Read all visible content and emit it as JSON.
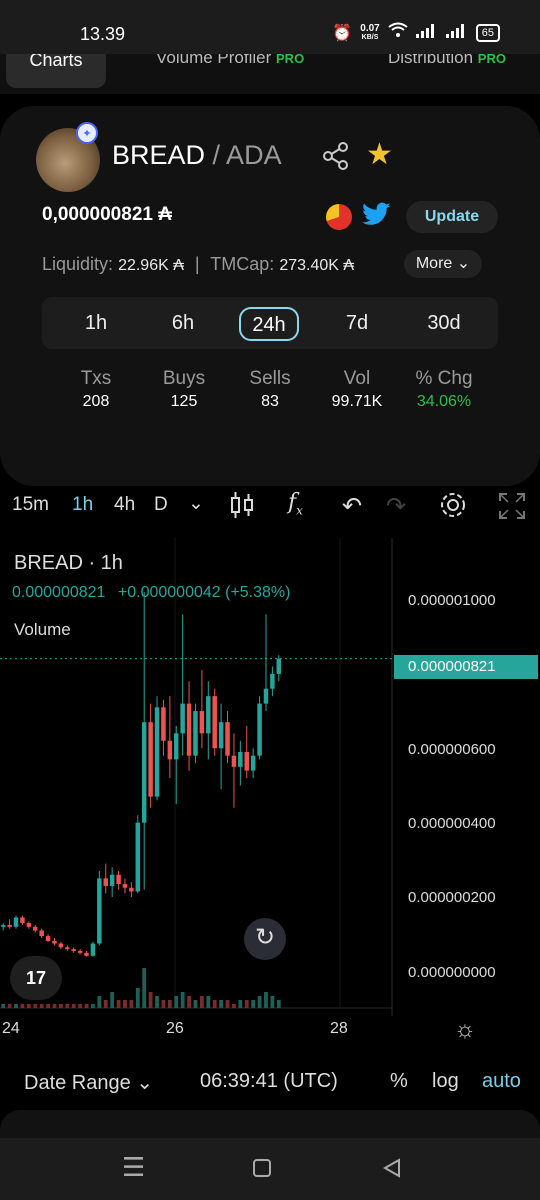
{
  "status_bar": {
    "time": "13.39",
    "net_speed": "0.07",
    "net_unit": "KB/S",
    "battery": "65"
  },
  "top_tabs": [
    {
      "label": "Charts",
      "pro": ""
    },
    {
      "label": "Volume Profiler",
      "pro": "PRO"
    },
    {
      "label": "Distribution",
      "pro": "PRO"
    }
  ],
  "token": {
    "base": "BREAD",
    "quote": "/ ADA",
    "price": "0,000000821 ₳",
    "update_label": "Update",
    "liquidity_label": "Liquidity:",
    "liquidity_value": "22.96K ₳",
    "separator": "|",
    "tmcap_label": "TMCap:",
    "tmcap_value": "273.40K ₳",
    "more_label": "More ⌄"
  },
  "timeframes": [
    "1h",
    "6h",
    "24h",
    "7d",
    "30d"
  ],
  "active_timeframe": "24h",
  "stats": [
    {
      "label": "Txs",
      "value": "208"
    },
    {
      "label": "Buys",
      "value": "125"
    },
    {
      "label": "Sells",
      "value": "83"
    },
    {
      "label": "Vol",
      "value": "99.71K"
    },
    {
      "label": "% Chg",
      "value": "34.06%"
    }
  ],
  "chart_toolbar": {
    "intervals": [
      "15m",
      "1h",
      "4h",
      "D"
    ],
    "active_interval": "1h",
    "dropdown": "⌄"
  },
  "chart_legend": {
    "title": "BREAD · 1h",
    "price": "0.000000821",
    "change": "+0.000000042 (+5.38%)",
    "volume_label": "Volume"
  },
  "chart_data": {
    "type": "candlestick",
    "series_name": "BREAD · 1h",
    "y_ticks": [
      "0.000001000",
      "0.000000800",
      "0.000000600",
      "0.000000400",
      "0.000000200",
      "0.000000000"
    ],
    "x_ticks": [
      "24",
      "26",
      "28"
    ],
    "last_price_label": "0.000000821",
    "ylim": [
      0,
      1.1e-06
    ],
    "colors": {
      "up": "#26a69a",
      "down": "#ef5350"
    },
    "candles_ohlc": [
      [
        1e-07,
        1.1e-07,
        9e-08,
        1.05e-07
      ],
      [
        1.05e-07,
        1.2e-07,
        9.5e-08,
        1e-07
      ],
      [
        1e-07,
        1.3e-07,
        9.5e-08,
        1.25e-07
      ],
      [
        1.25e-07,
        1.3e-07,
        1.05e-07,
        1.1e-07
      ],
      [
        1.1e-07,
        1.15e-07,
        9.5e-08,
        1e-07
      ],
      [
        1e-07,
        1.05e-07,
        8.5e-08,
        9e-08
      ],
      [
        9e-08,
        9.5e-08,
        7e-08,
        7.5e-08
      ],
      [
        7.5e-08,
        8e-08,
        6e-08,
        6.2e-08
      ],
      [
        6.2e-08,
        7e-08,
        5e-08,
        5.5e-08
      ],
      [
        5.5e-08,
        6e-08,
        4e-08,
        4.5e-08
      ],
      [
        4.5e-08,
        5e-08,
        3.5e-08,
        4e-08
      ],
      [
        4e-08,
        4.5e-08,
        3e-08,
        3.5e-08
      ],
      [
        3.5e-08,
        4e-08,
        2.5e-08,
        3e-08
      ],
      [
        3e-08,
        3.5e-08,
        2e-08,
        2.2e-08
      ],
      [
        2.2e-08,
        6e-08,
        2e-08,
        5.5e-08
      ],
      [
        5.5e-08,
        2.5e-07,
        5e-08,
        2.3e-07
      ],
      [
        2.3e-07,
        2.7e-07,
        1.9e-07,
        2.1e-07
      ],
      [
        2.1e-07,
        2.6e-07,
        1.8e-07,
        2.4e-07
      ],
      [
        2.4e-07,
        2.5e-07,
        2e-07,
        2.15e-07
      ],
      [
        2.15e-07,
        2.3e-07,
        1.9e-07,
        2.05e-07
      ],
      [
        2.05e-07,
        2.2e-07,
        1.8e-07,
        1.95e-07
      ],
      [
        1.95e-07,
        4e-07,
        1.9e-07,
        3.8e-07
      ],
      [
        3.8e-07,
        1e-06,
        2e-07,
        6.5e-07
      ],
      [
        6.5e-07,
        7e-07,
        4.2e-07,
        4.5e-07
      ],
      [
        4.5e-07,
        7.2e-07,
        4.4e-07,
        6.9e-07
      ],
      [
        6.9e-07,
        7.1e-07,
        5.6e-07,
        6e-07
      ],
      [
        6e-07,
        7.2e-07,
        5e-07,
        5.5e-07
      ],
      [
        5.5e-07,
        6.4e-07,
        4.3e-07,
        6.2e-07
      ],
      [
        6.2e-07,
        9.4e-07,
        5.6e-07,
        7e-07
      ],
      [
        7e-07,
        7.6e-07,
        5.2e-07,
        5.6e-07
      ],
      [
        5.6e-07,
        7e-07,
        5.4e-07,
        6.8e-07
      ],
      [
        6.8e-07,
        7.9e-07,
        5.8e-07,
        6.2e-07
      ],
      [
        6.2e-07,
        7.6e-07,
        5.5e-07,
        7.2e-07
      ],
      [
        7.2e-07,
        7.4e-07,
        5.6e-07,
        5.8e-07
      ],
      [
        5.8e-07,
        7e-07,
        4.7e-07,
        6.5e-07
      ],
      [
        6.5e-07,
        6.8e-07,
        5.4e-07,
        5.6e-07
      ],
      [
        5.6e-07,
        6.2e-07,
        4.2e-07,
        5.3e-07
      ],
      [
        5.3e-07,
        6e-07,
        4.8e-07,
        5.7e-07
      ],
      [
        5.7e-07,
        6.4e-07,
        5e-07,
        5.2e-07
      ],
      [
        5.2e-07,
        5.8e-07,
        5e-07,
        5.6e-07
      ],
      [
        5.6e-07,
        7.2e-07,
        5.5e-07,
        7e-07
      ],
      [
        7e-07,
        9.4e-07,
        6.8e-07,
        7.4e-07
      ],
      [
        7.4e-07,
        8e-07,
        7.2e-07,
        7.8e-07
      ],
      [
        7.8e-07,
        8.3e-07,
        7.6e-07,
        8.21e-07
      ]
    ],
    "volumes": [
      1,
      1,
      1,
      1,
      1,
      1,
      1,
      1,
      1,
      1,
      1,
      1,
      1,
      1,
      1,
      3,
      2,
      4,
      2,
      2,
      2,
      5,
      10,
      4,
      3,
      2,
      2,
      3,
      4,
      3,
      2,
      3,
      3,
      2,
      2,
      2,
      1,
      2,
      2,
      2,
      3,
      4,
      3,
      2
    ]
  },
  "footer": {
    "date_range": "Date Range ⌄",
    "time": "06:39:41 (UTC)",
    "percent": "%",
    "log": "log",
    "auto": "auto"
  },
  "logo_text": "17"
}
